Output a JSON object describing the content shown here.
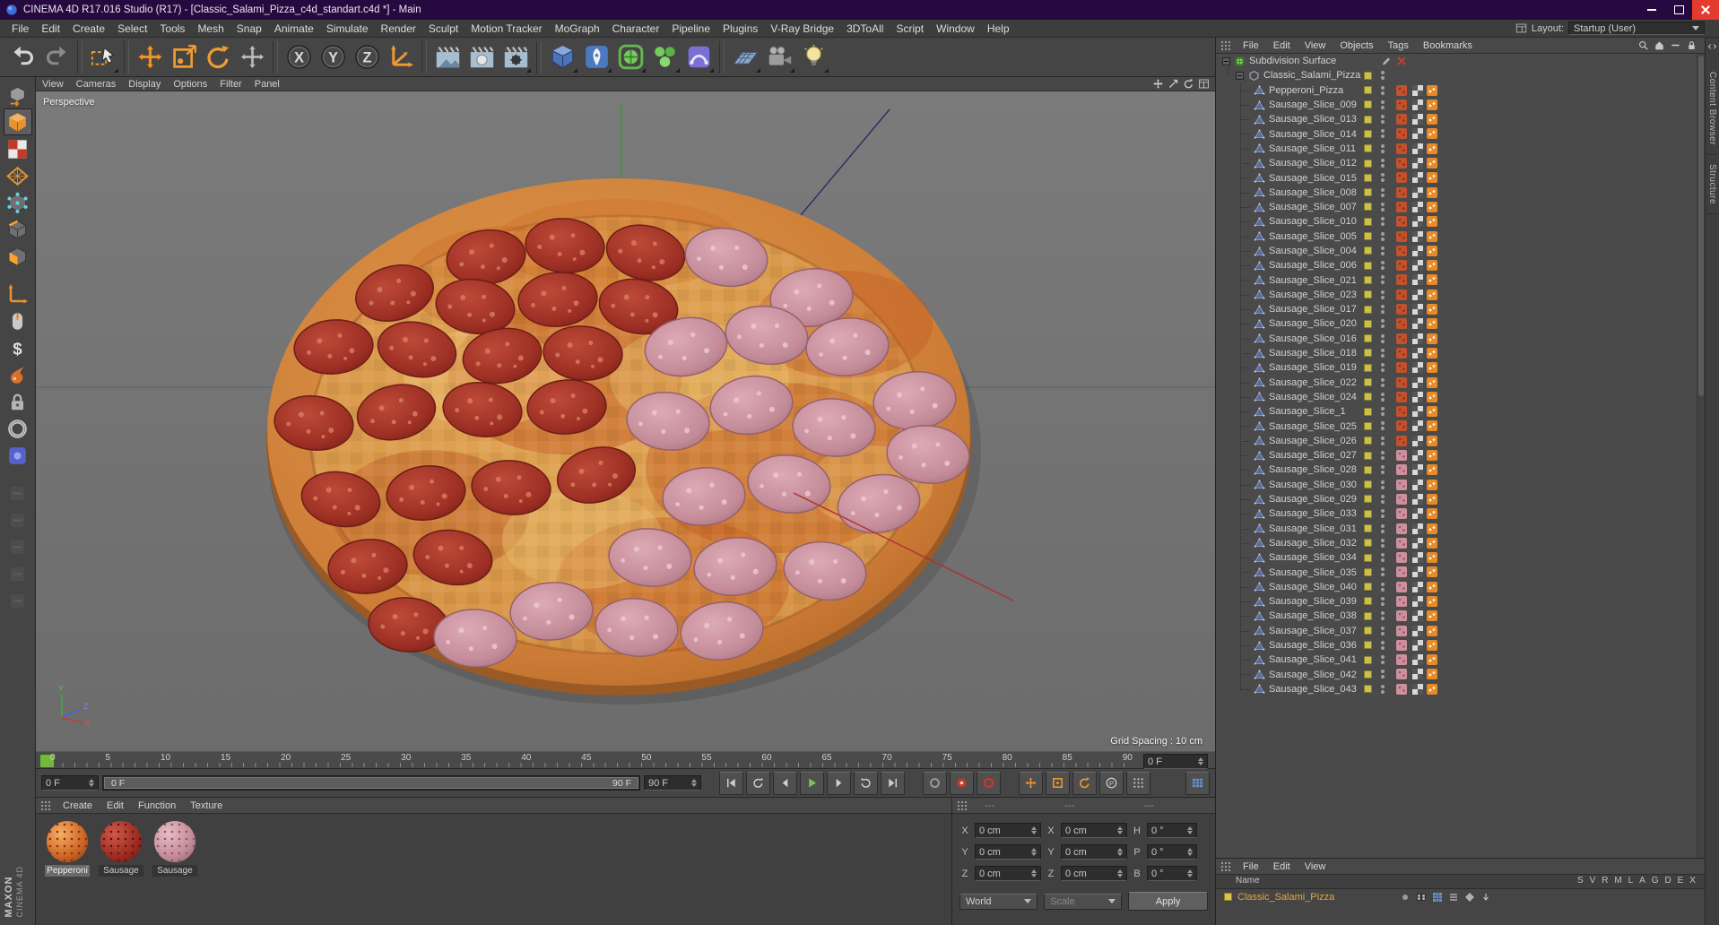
{
  "window": {
    "title": "CINEMA 4D R17.016 Studio (R17) - [Classic_Salami_Pizza_c4d_standart.c4d *] - Main"
  },
  "menu_bar": {
    "items": [
      "File",
      "Edit",
      "Create",
      "Select",
      "Tools",
      "Mesh",
      "Snap",
      "Animate",
      "Simulate",
      "Render",
      "Sculpt",
      "Motion Tracker",
      "MoGraph",
      "Character",
      "Pipeline",
      "Plugins",
      "V-Ray Bridge",
      "3DToAll",
      "Script",
      "Window",
      "Help"
    ],
    "layout_label": "Layout:",
    "layout_value": "Startup (User)"
  },
  "toolbar": {
    "items": [
      "undo",
      "redo",
      "sep",
      "live-selection",
      "sep",
      "move",
      "scale",
      "rotate",
      "last-tool",
      "sep",
      "axis-x",
      "axis-y",
      "axis-z",
      "coordinate-system",
      "sep",
      "render-view",
      "render-picture-viewer",
      "render-settings",
      "sep",
      "primitive-cube",
      "spline-pen",
      "subdivision-surface",
      "cloner",
      "deformer",
      "sep",
      "floor",
      "camera",
      "light"
    ],
    "axis_letters": {
      "axis-x": "X",
      "axis-y": "Y",
      "axis-z": "Z"
    },
    "flyout_buttons": [
      "live-selection",
      "render-settings",
      "primitive-cube",
      "spline-pen",
      "subdivision-surface",
      "cloner",
      "deformer",
      "floor",
      "camera",
      "light"
    ]
  },
  "left_toolbar": {
    "items": [
      "make-editable",
      "model-mode",
      "texture-mode",
      "workplane-mode",
      "points-mode",
      "edges-mode",
      "polygons-mode",
      "gap",
      "axis-mode",
      "snap-mouse",
      "viewport-solo",
      "paint-tool",
      "lock-tool",
      "rotate-ring",
      "plugin-tool",
      "gap",
      "extra-tool-1",
      "extra-tool-2",
      "extra-tool-3",
      "extra-tool-4",
      "extra-tool-5"
    ],
    "active": "model-mode"
  },
  "viewport": {
    "menu": [
      "View",
      "Cameras",
      "Display",
      "Options",
      "Filter",
      "Panel"
    ],
    "label": "Perspective",
    "grid": "Grid Spacing : 10 cm",
    "axis_labels": {
      "x": "X",
      "y": "Y",
      "z": "Z"
    }
  },
  "object_manager": {
    "menu": [
      "File",
      "Edit",
      "View",
      "Objects",
      "Tags",
      "Bookmarks"
    ],
    "root": "Subdivision Surface",
    "parent": "Classic_Salami_Pizza",
    "children": [
      "Pepperoni_Pizza",
      "Sausage_Slice_009",
      "Sausage_Slice_013",
      "Sausage_Slice_014",
      "Sausage_Slice_011",
      "Sausage_Slice_012",
      "Sausage_Slice_015",
      "Sausage_Slice_008",
      "Sausage_Slice_007",
      "Sausage_Slice_010",
      "Sausage_Slice_005",
      "Sausage_Slice_004",
      "Sausage_Slice_006",
      "Sausage_Slice_021",
      "Sausage_Slice_023",
      "Sausage_Slice_017",
      "Sausage_Slice_020",
      "Sausage_Slice_016",
      "Sausage_Slice_018",
      "Sausage_Slice_019",
      "Sausage_Slice_022",
      "Sausage_Slice_024",
      "Sausage_Slice_1",
      "Sausage_Slice_025",
      "Sausage_Slice_026",
      "Sausage_Slice_027",
      "Sausage_Slice_028",
      "Sausage_Slice_030",
      "Sausage_Slice_029",
      "Sausage_Slice_033",
      "Sausage_Slice_031",
      "Sausage_Slice_032",
      "Sausage_Slice_034",
      "Sausage_Slice_035",
      "Sausage_Slice_040",
      "Sausage_Slice_039",
      "Sausage_Slice_038",
      "Sausage_Slice_037",
      "Sausage_Slice_036",
      "Sausage_Slice_041",
      "Sausage_Slice_042",
      "Sausage_Slice_043"
    ]
  },
  "timeline": {
    "labels": [
      "0",
      "5",
      "10",
      "15",
      "20",
      "25",
      "30",
      "35",
      "40",
      "45",
      "50",
      "55",
      "60",
      "65",
      "70",
      "75",
      "80",
      "85",
      "90"
    ],
    "current": "0 F"
  },
  "transport": {
    "current": "0 F",
    "range_start": "0 F",
    "range_end": "90 F",
    "end": "90 F",
    "buttons": [
      "goto-start",
      "loop-left",
      "prev-frame",
      "play",
      "next-frame",
      "loop-right",
      "goto-end"
    ],
    "record_buttons": [
      "record-ghost",
      "record-keyframe",
      "autokey"
    ],
    "key_buttons": [
      "rec-position",
      "rec-scale",
      "rec-rotation",
      "rec-parameter",
      "rec-pla"
    ]
  },
  "materials": {
    "menu": [
      "Create",
      "Edit",
      "Function",
      "Texture"
    ],
    "items": [
      {
        "name": "Pepperoni",
        "type": "pepperoni"
      },
      {
        "name": "Sausage",
        "type": "salami"
      },
      {
        "name": "Sausage",
        "type": "sausage"
      }
    ]
  },
  "coordinates": {
    "headers": [
      "---",
      "---",
      "---"
    ],
    "rows": [
      {
        "pos_label": "X",
        "pos": "0 cm",
        "size_label": "X",
        "size": "0 cm",
        "rot_label": "H",
        "rot": "0 °"
      },
      {
        "pos_label": "Y",
        "pos": "0 cm",
        "size_label": "Y",
        "size": "0 cm",
        "rot_label": "P",
        "rot": "0 °"
      },
      {
        "pos_label": "Z",
        "pos": "0 cm",
        "size_label": "Z",
        "size": "0 cm",
        "rot_label": "B",
        "rot": "0 °"
      }
    ],
    "world": "World",
    "size_mode": "Scale",
    "apply": "Apply"
  },
  "layer_manager": {
    "menu": [
      "File",
      "Edit",
      "View"
    ],
    "name_header": "Name",
    "columns": [
      "S",
      "V",
      "R",
      "M",
      "L",
      "A",
      "G",
      "D",
      "E",
      "X"
    ],
    "rows": [
      {
        "name": "Classic_Salami_Pizza"
      }
    ]
  },
  "side_tabs": {
    "labels": [
      "Content Browser",
      "Structure"
    ]
  },
  "brand": {
    "maxon": "MAXON",
    "cinema": "CINEMA 4D"
  },
  "colors": {
    "accent_orange": "#ef9b30",
    "play_green": "#7ec14f",
    "record_red": "#c8372c",
    "layer_name_orange": "#e8a43c",
    "marker_green": "#74b83e"
  }
}
